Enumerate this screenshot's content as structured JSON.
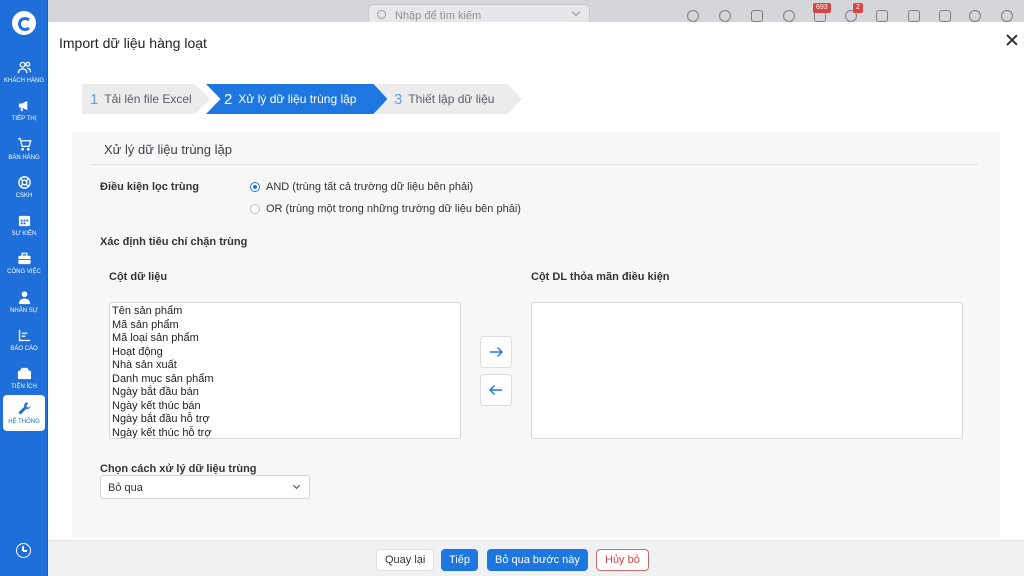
{
  "search": {
    "placeholder": "Nhập để tìm kiếm"
  },
  "topbar": {
    "badges": [
      "693",
      "2"
    ]
  },
  "sidebar": {
    "items": [
      {
        "label": "KHÁCH HÀNG",
        "icon": "users-icon"
      },
      {
        "label": "TIẾP THỊ",
        "icon": "megaphone-icon"
      },
      {
        "label": "BÁN HÀNG",
        "icon": "cart-icon"
      },
      {
        "label": "CSKH",
        "icon": "lifebuoy-icon"
      },
      {
        "label": "SỰ KIỆN",
        "icon": "calendar-icon"
      },
      {
        "label": "CÔNG VIỆC",
        "icon": "briefcase-icon"
      },
      {
        "label": "NHÂN SỰ",
        "icon": "person-icon"
      },
      {
        "label": "BÁO CÁO",
        "icon": "report-icon"
      },
      {
        "label": "TIỆN ÍCH",
        "icon": "utilities-icon"
      },
      {
        "label": "HỆ THỐNG",
        "icon": "wrench-icon",
        "active": true
      }
    ]
  },
  "modal": {
    "title": "Import dữ liệu hàng loạt",
    "steps": [
      {
        "num": "1",
        "label": "Tải lên file Excel"
      },
      {
        "num": "2",
        "label": "Xử lý dữ liệu trùng lặp"
      },
      {
        "num": "3",
        "label": "Thiết lập dữ liệu"
      }
    ],
    "section_title": "Xử lý dữ liệu trùng lặp",
    "condition_label": "Điều kiện lọc trùng",
    "options": [
      "AND (trùng tất cả trường dữ liệu bên phải)",
      "OR (trùng một trong những trường dữ liệu bên phải)"
    ],
    "criteria_label": "Xác định tiêu chí chặn trùng",
    "columns_label": "Cột dữ liệu",
    "matching_label": "Cột DL thỏa mãn điều kiện",
    "columns": [
      "Tên sản phẩm",
      "Mã sản phẩm",
      "Mã loại sản phẩm",
      "Hoạt động",
      "Nhà sản xuất",
      "Danh mục sản phẩm",
      "Ngày bắt đầu bán",
      "Ngày kết thúc bán",
      "Ngày bắt đầu hỗ trợ",
      "Ngày kết thúc hỗ trợ"
    ],
    "handling_label": "Chọn cách xử lý dữ liệu trùng",
    "handling_value": "Bỏ qua"
  },
  "footer": {
    "back": "Quay lại",
    "next": "Tiếp",
    "skip": "Bỏ qua bước này",
    "cancel": "Hủy bỏ"
  }
}
